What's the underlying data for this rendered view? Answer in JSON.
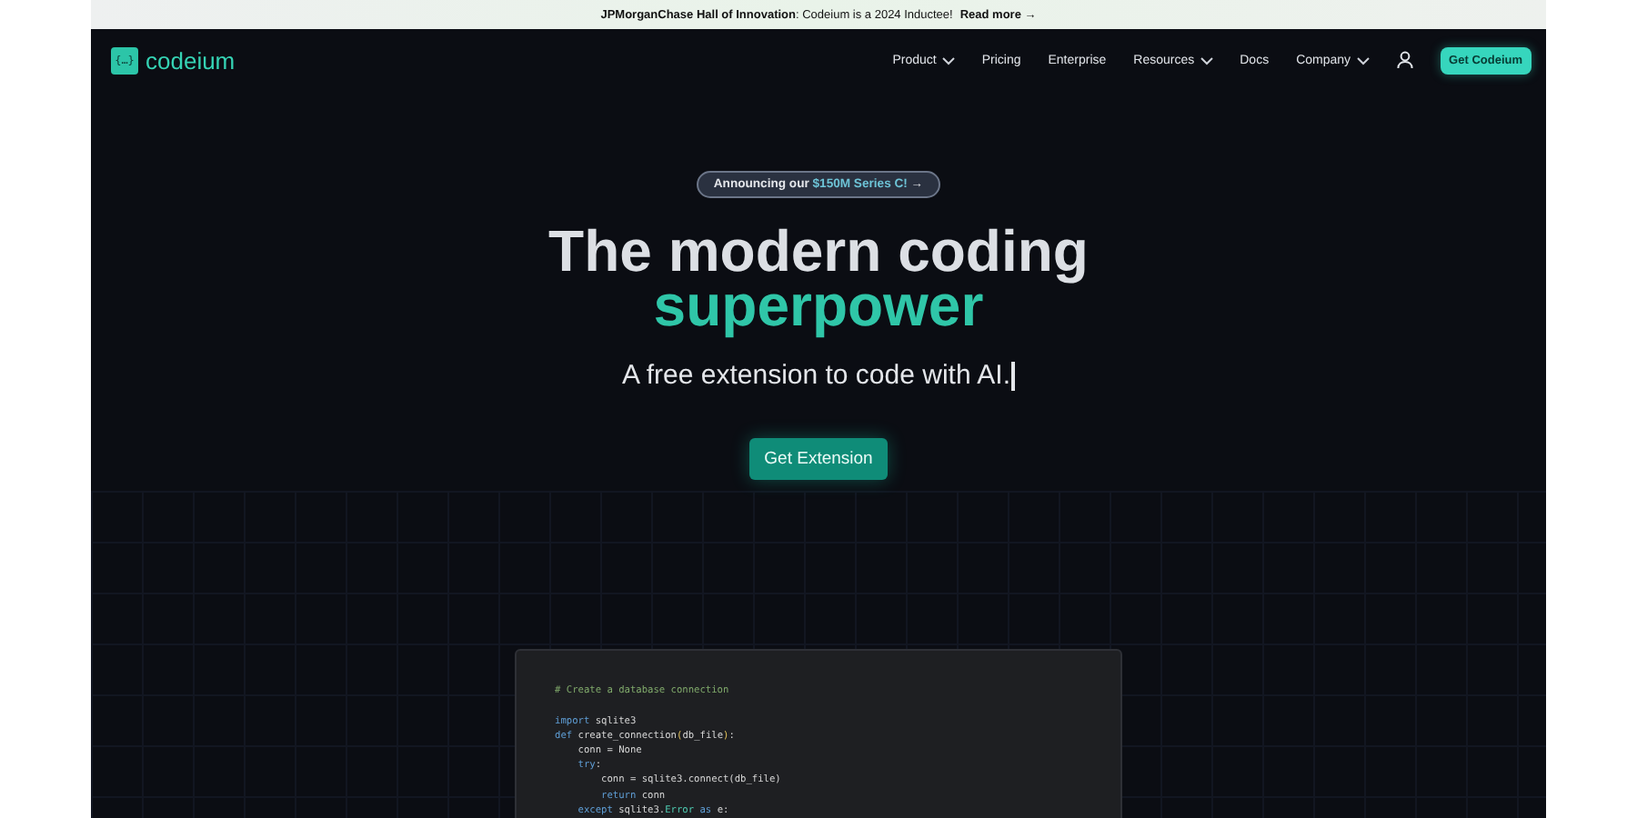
{
  "banner": {
    "title": "JPMorganChase Hall of Innovation",
    "text": ": Codeium is a 2024 Inductee!",
    "link": "Read more",
    "arrow": "→"
  },
  "nav": {
    "logo_mark": "{…}",
    "logo": "codeium",
    "items": [
      {
        "label": "Product",
        "dropdown": true
      },
      {
        "label": "Pricing",
        "dropdown": false
      },
      {
        "label": "Enterprise",
        "dropdown": false
      },
      {
        "label": "Resources",
        "dropdown": true
      },
      {
        "label": "Docs",
        "dropdown": false
      },
      {
        "label": "Company",
        "dropdown": true
      }
    ],
    "cta": "Get Codeium"
  },
  "hero": {
    "announcement": {
      "prefix": "Announcing our",
      "highlight": "$150M Series C!",
      "arrow": "→"
    },
    "title_line_1": "The modern coding",
    "title_line_2": "superpower",
    "subtitle": "A free extension to code with AI.",
    "button": "Get Extension"
  },
  "code": [
    [
      {
        "text": "# Create a database connection",
        "kind": "comment"
      }
    ],
    [
      {
        "text": "import",
        "kind": "keyword"
      },
      {
        "text": " sqlite3",
        "kind": "plain"
      }
    ],
    [
      {
        "text": "def",
        "kind": "keyword"
      },
      {
        "text": " create_connection",
        "kind": "plain"
      },
      {
        "text": "(",
        "kind": "paren"
      },
      {
        "text": "db_file",
        "kind": "plain"
      },
      {
        "text": ")",
        "kind": "paren"
      },
      {
        "text": ":",
        "kind": "plain"
      }
    ],
    [
      {
        "text": "    conn = None",
        "kind": "plain"
      }
    ],
    [
      {
        "text": "    try",
        "kind": "keyword"
      },
      {
        "text": ":",
        "kind": "plain"
      }
    ],
    [
      {
        "text": "        conn = sqlite3.connect(db_file)",
        "kind": "plain"
      }
    ],
    [
      {
        "text": "        return",
        "kind": "keyword"
      },
      {
        "text": " conn",
        "kind": "plain"
      }
    ],
    [
      {
        "text": "    except",
        "kind": "keyword"
      },
      {
        "text": " sqlite3.",
        "kind": "plain"
      },
      {
        "text": "Error",
        "kind": "type"
      },
      {
        "text": " as",
        "kind": "keyword"
      },
      {
        "text": " e:",
        "kind": "plain"
      }
    ]
  ]
}
